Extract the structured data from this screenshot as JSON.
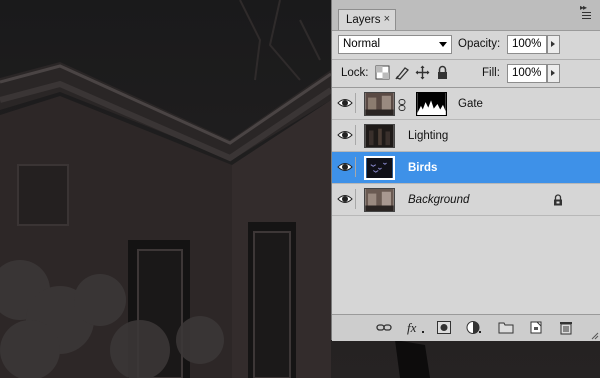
{
  "panel": {
    "tab_label": "Layers",
    "close_glyph": "×"
  },
  "blend_mode": {
    "value": "Normal"
  },
  "opacity": {
    "label": "Opacity:",
    "value": "100%"
  },
  "lock": {
    "label": "Lock:"
  },
  "fill": {
    "label": "Fill:",
    "value": "100%"
  },
  "layers": [
    {
      "name": "Gate",
      "visible": true,
      "selected": false,
      "has_mask": true,
      "italic": false,
      "locked": false
    },
    {
      "name": "Lighting",
      "visible": true,
      "selected": false,
      "has_mask": false,
      "italic": false,
      "locked": false
    },
    {
      "name": "Birds",
      "visible": true,
      "selected": true,
      "has_mask": false,
      "italic": false,
      "locked": false
    },
    {
      "name": "Background",
      "visible": true,
      "selected": false,
      "has_mask": false,
      "italic": true,
      "locked": true
    }
  ],
  "footer_icons": [
    "link-layers-icon",
    "fx-icon",
    "add-mask-icon",
    "adjustment-layer-icon",
    "new-group-icon",
    "new-layer-icon",
    "delete-layer-icon"
  ],
  "colors": {
    "selection": "#3e91e8",
    "panel_bg": "#d6d6d6"
  }
}
